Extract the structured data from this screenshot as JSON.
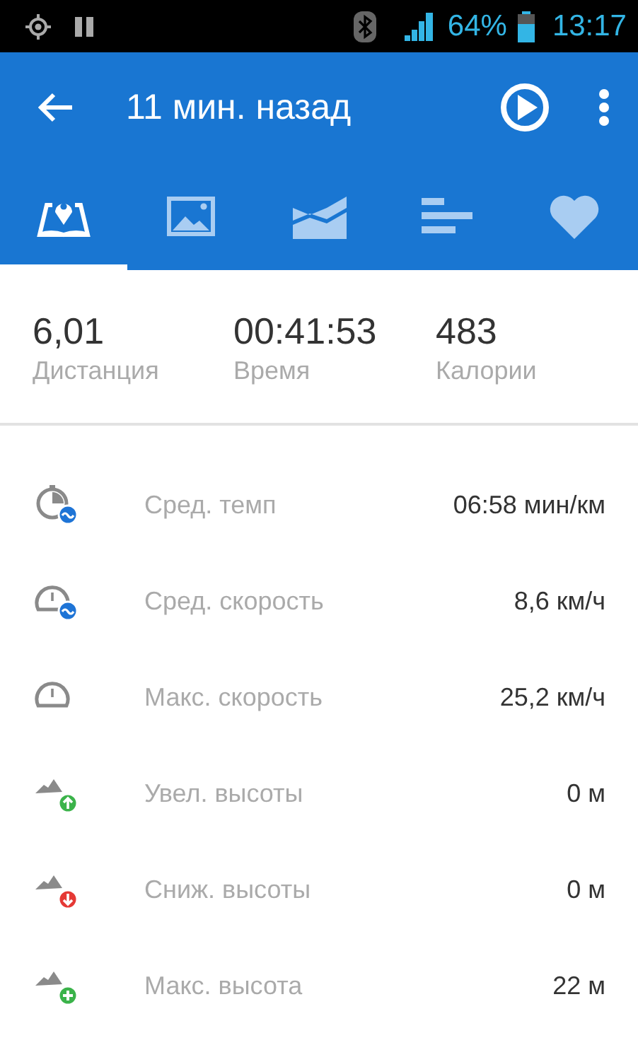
{
  "status_bar": {
    "battery": "64%",
    "time": "13:17"
  },
  "app_bar": {
    "title": "11 мин. назад"
  },
  "tabs": [
    {
      "kind": "map",
      "selected": true
    },
    {
      "kind": "photo",
      "selected": false
    },
    {
      "kind": "chart",
      "selected": false
    },
    {
      "kind": "bars",
      "selected": false
    },
    {
      "kind": "heart",
      "selected": false
    }
  ],
  "summary": [
    {
      "value": "6,01",
      "label": "Дистанция"
    },
    {
      "value": "00:41:53",
      "label": "Время"
    },
    {
      "value": "483",
      "label": "Калории"
    }
  ],
  "stats": [
    {
      "kind": "pace",
      "label": "Сред. темп",
      "value": "06:58 мин/км"
    },
    {
      "kind": "avg_speed",
      "label": "Сред. скорость",
      "value": "8,6 км/ч"
    },
    {
      "kind": "max_speed",
      "label": "Макс. скорость",
      "value": "25,2 км/ч"
    },
    {
      "kind": "elev_gain",
      "label": "Увел. высоты",
      "value": "0 м"
    },
    {
      "kind": "elev_loss",
      "label": "Сниж. высоты",
      "value": "0 м"
    },
    {
      "kind": "elev_max",
      "label": "Макс. высота",
      "value": "22 м"
    }
  ]
}
